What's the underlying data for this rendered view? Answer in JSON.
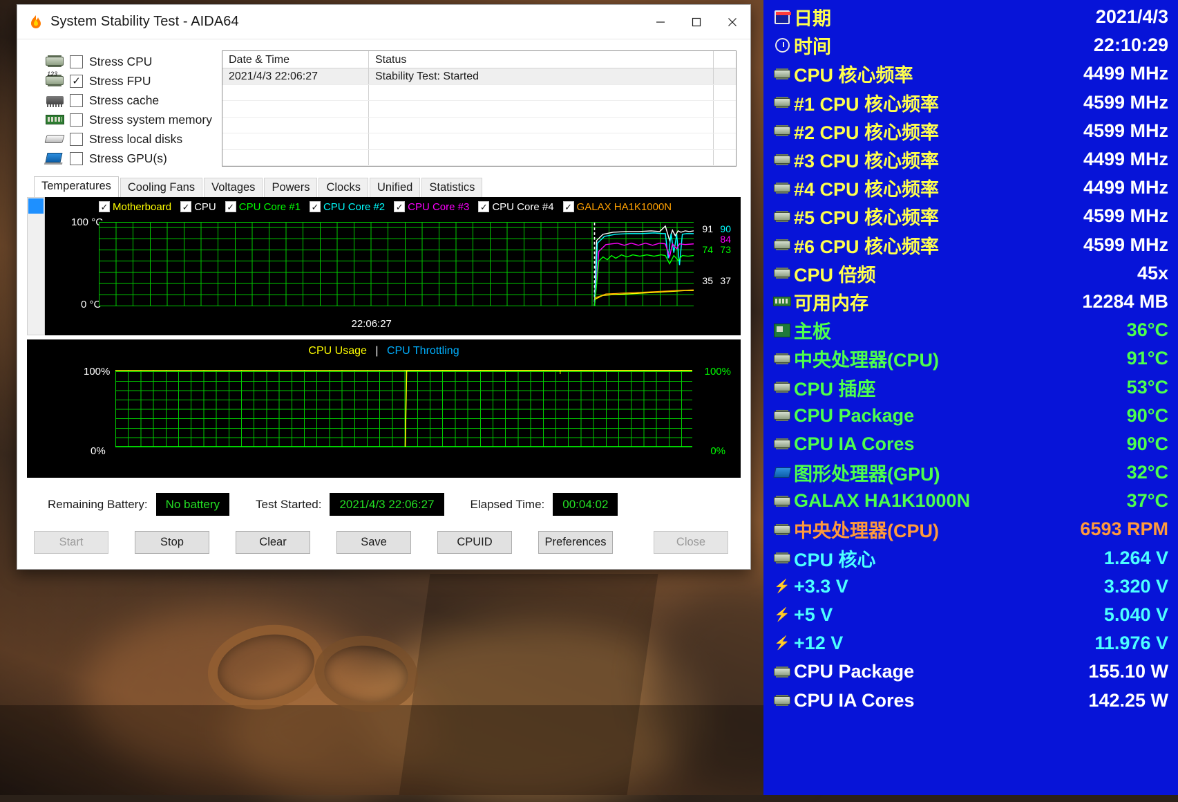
{
  "window": {
    "title": "System Stability Test - AIDA64",
    "icon": "flame-icon",
    "controls": {
      "minimize": "─",
      "maximize": "☐",
      "close": "✕"
    }
  },
  "stress_options": [
    {
      "label": "Stress CPU",
      "checked": false,
      "icon": "cpu-chip-icon"
    },
    {
      "label": "Stress FPU",
      "checked": true,
      "icon": "fpu-chip-icon"
    },
    {
      "label": "Stress cache",
      "checked": false,
      "icon": "cache-chip-icon"
    },
    {
      "label": "Stress system memory",
      "checked": false,
      "icon": "memory-module-icon"
    },
    {
      "label": "Stress local disks",
      "checked": false,
      "icon": "hard-disk-icon"
    },
    {
      "label": "Stress GPU(s)",
      "checked": false,
      "icon": "gpu-card-icon"
    }
  ],
  "log_table": {
    "columns": [
      "Date & Time",
      "Status"
    ],
    "rows": [
      {
        "datetime": "2021/4/3 22:06:27",
        "status": "Stability Test: Started"
      }
    ],
    "empty_rows": 5
  },
  "tabs": [
    {
      "label": "Temperatures",
      "active": true
    },
    {
      "label": "Cooling Fans",
      "active": false
    },
    {
      "label": "Voltages",
      "active": false
    },
    {
      "label": "Powers",
      "active": false
    },
    {
      "label": "Clocks",
      "active": false
    },
    {
      "label": "Unified",
      "active": false
    },
    {
      "label": "Statistics",
      "active": false
    }
  ],
  "temp_graph": {
    "legend": [
      {
        "label": "Motherboard",
        "color": "#ffff00",
        "checked": true
      },
      {
        "label": "CPU",
        "color": "#ffffff",
        "checked": true
      },
      {
        "label": "CPU Core #1",
        "color": "#00ff00",
        "checked": true
      },
      {
        "label": "CPU Core #2",
        "color": "#00ffff",
        "checked": true
      },
      {
        "label": "CPU Core #3",
        "color": "#ff00ff",
        "checked": true
      },
      {
        "label": "CPU Core #4",
        "color": "#ffffff",
        "checked": true
      },
      {
        "label": "GALAX HA1K1000N",
        "color": "#ffa000",
        "checked": true
      }
    ],
    "y_top": "100 °C",
    "y_bottom": "0 °C",
    "x_time": "22:06:27",
    "value_labels": [
      {
        "text": "91",
        "color": "#ffffff"
      },
      {
        "text": "90",
        "color": "#00ffff"
      },
      {
        "text": "84",
        "color": "#ff00ff"
      },
      {
        "text": "74",
        "color": "#00ff00"
      },
      {
        "text": "73",
        "color": "#00ff00"
      },
      {
        "text": "35",
        "color": "#ffff00"
      },
      {
        "text": "37",
        "color": "#ffa000"
      }
    ]
  },
  "usage_graph": {
    "title_cpu_usage": "CPU Usage",
    "separator": "|",
    "title_throttling": "CPU Throttling",
    "usage_color": "#ffff00",
    "throttling_color": "#00b0ff",
    "y_top_left": "100%",
    "y_bottom_left": "0%",
    "y_top_right": "100%",
    "y_bottom_right": "0%"
  },
  "status": {
    "battery_label": "Remaining Battery:",
    "battery_value": "No battery",
    "started_label": "Test Started:",
    "started_value": "2021/4/3 22:06:27",
    "elapsed_label": "Elapsed Time:",
    "elapsed_value": "00:04:02"
  },
  "buttons": [
    {
      "label": "Start",
      "disabled": true,
      "accel": "S"
    },
    {
      "label": "Stop",
      "disabled": false,
      "accel": "t"
    },
    {
      "label": "Clear",
      "disabled": false,
      "accel": "l"
    },
    {
      "label": "Save",
      "disabled": false,
      "accel": "a"
    },
    {
      "label": "CPUID",
      "disabled": false,
      "accel": "U"
    },
    {
      "label": "Preferences",
      "disabled": false,
      "accel": "e"
    },
    {
      "label": "Close",
      "disabled": true,
      "accel": "C"
    }
  ],
  "sensor_panel": {
    "background": "#0714d8",
    "rows": [
      {
        "icon": "calendar-icon",
        "name": "日期",
        "name_color": "#ffff4d",
        "value": "2021/4/3",
        "value_color": "#ffffff"
      },
      {
        "icon": "clock-icon",
        "name": "时间",
        "name_color": "#ffff4d",
        "value": "22:10:29",
        "value_color": "#ffffff"
      },
      {
        "icon": "cpu-chip-icon",
        "name": "CPU 核心频率",
        "name_color": "#ffff4d",
        "value": "4499 MHz",
        "value_color": "#ffffff"
      },
      {
        "icon": "cpu-chip-icon",
        "name": "#1 CPU 核心频率",
        "name_color": "#ffff4d",
        "value": "4599 MHz",
        "value_color": "#ffffff"
      },
      {
        "icon": "cpu-chip-icon",
        "name": "#2 CPU 核心频率",
        "name_color": "#ffff4d",
        "value": "4599 MHz",
        "value_color": "#ffffff"
      },
      {
        "icon": "cpu-chip-icon",
        "name": "#3 CPU 核心频率",
        "name_color": "#ffff4d",
        "value": "4499 MHz",
        "value_color": "#ffffff"
      },
      {
        "icon": "cpu-chip-icon",
        "name": "#4 CPU 核心频率",
        "name_color": "#ffff4d",
        "value": "4499 MHz",
        "value_color": "#ffffff"
      },
      {
        "icon": "cpu-chip-icon",
        "name": "#5 CPU 核心频率",
        "name_color": "#ffff4d",
        "value": "4599 MHz",
        "value_color": "#ffffff"
      },
      {
        "icon": "cpu-chip-icon",
        "name": "#6 CPU 核心频率",
        "name_color": "#ffff4d",
        "value": "4599 MHz",
        "value_color": "#ffffff"
      },
      {
        "icon": "cpu-chip-icon",
        "name": "CPU 倍频",
        "name_color": "#ffff4d",
        "value": "45x",
        "value_color": "#ffffff"
      },
      {
        "icon": "memory-module-icon",
        "name": "可用内存",
        "name_color": "#ffff4d",
        "value": "12284 MB",
        "value_color": "#ffffff"
      },
      {
        "icon": "motherboard-icon",
        "name": "主板",
        "name_color": "#4dff4d",
        "value": "36°C",
        "value_color": "#4dff4d"
      },
      {
        "icon": "cpu-chip-icon",
        "name": "中央处理器(CPU)",
        "name_color": "#4dff4d",
        "value": "91°C",
        "value_color": "#4dff4d"
      },
      {
        "icon": "cpu-chip-icon",
        "name": "CPU 插座",
        "name_color": "#4dff4d",
        "value": "53°C",
        "value_color": "#4dff4d"
      },
      {
        "icon": "cpu-chip-icon",
        "name": "CPU Package",
        "name_color": "#4dff4d",
        "value": "90°C",
        "value_color": "#4dff4d"
      },
      {
        "icon": "cpu-chip-icon",
        "name": "CPU IA Cores",
        "name_color": "#4dff4d",
        "value": "90°C",
        "value_color": "#4dff4d"
      },
      {
        "icon": "gpu-card-icon",
        "name": "图形处理器(GPU)",
        "name_color": "#4dff4d",
        "value": "32°C",
        "value_color": "#4dff4d"
      },
      {
        "icon": "cpu-chip-icon",
        "name": "GALAX HA1K1000N",
        "name_color": "#4dff4d",
        "value": "37°C",
        "value_color": "#4dff4d"
      },
      {
        "icon": "cpu-chip-icon",
        "name": "中央处理器(CPU)",
        "name_color": "#ff9a3c",
        "value": "6593 RPM",
        "value_color": "#ff9a3c"
      },
      {
        "icon": "cpu-chip-icon",
        "name": "CPU 核心",
        "name_color": "#4dffff",
        "value": "1.264 V",
        "value_color": "#4dffff"
      },
      {
        "icon": "bolt-icon",
        "name": "+3.3 V",
        "name_color": "#4dffff",
        "value": "3.320 V",
        "value_color": "#4dffff"
      },
      {
        "icon": "bolt-icon",
        "name": "+5 V",
        "name_color": "#4dffff",
        "value": "5.040 V",
        "value_color": "#4dffff"
      },
      {
        "icon": "bolt-icon",
        "name": "+12 V",
        "name_color": "#4dffff",
        "value": "11.976 V",
        "value_color": "#4dffff"
      },
      {
        "icon": "cpu-chip-icon",
        "name": "CPU Package",
        "name_color": "#ffffff",
        "value": "155.10 W",
        "value_color": "#ffffff"
      },
      {
        "icon": "cpu-chip-icon",
        "name": "CPU IA Cores",
        "name_color": "#ffffff",
        "value": "142.25 W",
        "value_color": "#ffffff"
      }
    ]
  }
}
